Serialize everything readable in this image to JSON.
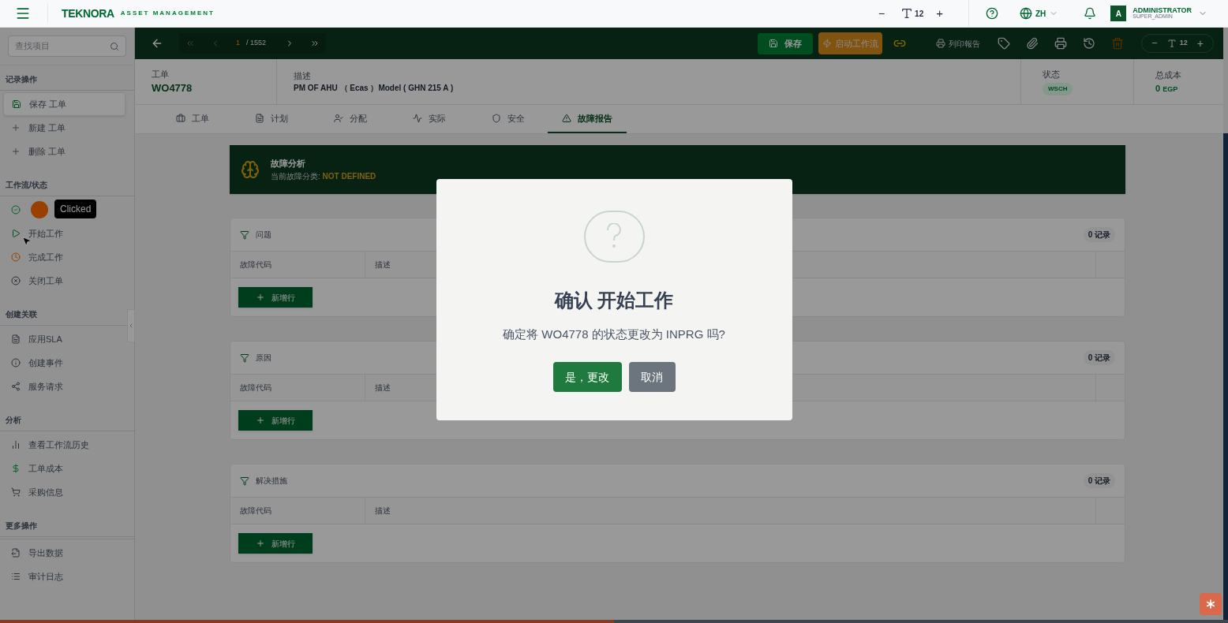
{
  "header": {
    "logo": "TEKNORA",
    "subtitle": "ASSET MANAGEMENT",
    "font_minus": "−",
    "font_size": "12",
    "font_plus": "+",
    "language": "ZH",
    "user": {
      "initial": "A",
      "name": "ADMINISTRATOR",
      "role": "SUPER_ADMIN"
    }
  },
  "sidebar": {
    "search_placeholder": "查找项目",
    "sections": [
      {
        "title": "记录操作",
        "items": [
          {
            "kind": "save",
            "label": "保存 工单",
            "selected": true
          },
          {
            "kind": "plus",
            "label": "新建 工单",
            "selected": false
          },
          {
            "kind": "plus",
            "label": "删除 工单",
            "selected": false
          }
        ]
      },
      {
        "title": "工作流/状态",
        "items": [
          {
            "kind": "check",
            "selected": false,
            "clicked": true
          },
          {
            "kind": "play",
            "label": "开始工作",
            "selected": false,
            "pointer": true
          },
          {
            "kind": "complete",
            "label": "完成工作",
            "selected": false
          },
          {
            "kind": "close",
            "label": "关闭工单",
            "selected": false
          }
        ]
      },
      {
        "title": "创建关联",
        "items": [
          {
            "kind": "file",
            "label": "应用SLA",
            "selected": false
          },
          {
            "kind": "info",
            "label": "创建事件",
            "selected": false
          },
          {
            "kind": "share",
            "label": "服务请求",
            "selected": false
          }
        ]
      },
      {
        "title": "分析",
        "items": [
          {
            "kind": "chart",
            "label": "查看工作流历史",
            "selected": false
          },
          {
            "kind": "dollar",
            "label": "工单成本",
            "selected": false
          },
          {
            "kind": "cart",
            "label": "采购信息",
            "selected": false
          }
        ]
      },
      {
        "title": "更多操作",
        "items": [
          {
            "kind": "export",
            "label": "导出数据",
            "selected": false
          },
          {
            "kind": "list",
            "label": "审计日志",
            "selected": false
          }
        ]
      }
    ]
  },
  "tooltip": "Clicked",
  "toolbar": {
    "pager": {
      "current": "1",
      "total": "/ 1552"
    },
    "save": "保存",
    "workflow": "启动工作流",
    "report": "列印報告",
    "font_minus": "−",
    "font_size": "12",
    "font_plus": "+"
  },
  "record": {
    "fields": [
      {
        "label": "工单",
        "value": "WO4778",
        "kind": "id"
      },
      {
        "label": "描述",
        "value": "PM OF AHU （ Ecas ）Model ( GHN 215 A )",
        "kind": "text"
      }
    ],
    "status_label": "状态",
    "status": "WSCH",
    "cost_label": "总成本",
    "cost": "0",
    "currency": "EGP"
  },
  "tabs": [
    {
      "kind": "briefcase",
      "label": "工单",
      "selected": false
    },
    {
      "kind": "file",
      "label": "计划",
      "selected": false
    },
    {
      "kind": "user",
      "label": "分配",
      "selected": false
    },
    {
      "kind": "activity",
      "label": "实际",
      "selected": false
    },
    {
      "kind": "shield",
      "label": "安全",
      "selected": false
    },
    {
      "kind": "warning",
      "label": "故障报告",
      "selected": true
    }
  ],
  "banner": {
    "title": "故障分析",
    "subtitle": "当前故障分类:",
    "value": "NOT DEFINED"
  },
  "sections": [
    {
      "title": "问题",
      "count": "0 记录",
      "columns": [
        "故障代码",
        "描述"
      ],
      "add": "新增行"
    },
    {
      "title": "原因",
      "count": "0 记录",
      "columns": [
        "故障代码",
        "描述"
      ],
      "add": "新增行"
    },
    {
      "title": "解决措施",
      "count": "0 记录",
      "columns": [
        "故障代码",
        "描述"
      ],
      "add": "新增行"
    }
  ],
  "dialog": {
    "title": "确认 开始工作",
    "message": "确定将 WO4778 的状态更改为 INPRG 吗?",
    "confirm": "是，更改",
    "cancel": "取消"
  },
  "progress": {
    "level": 0.5
  }
}
